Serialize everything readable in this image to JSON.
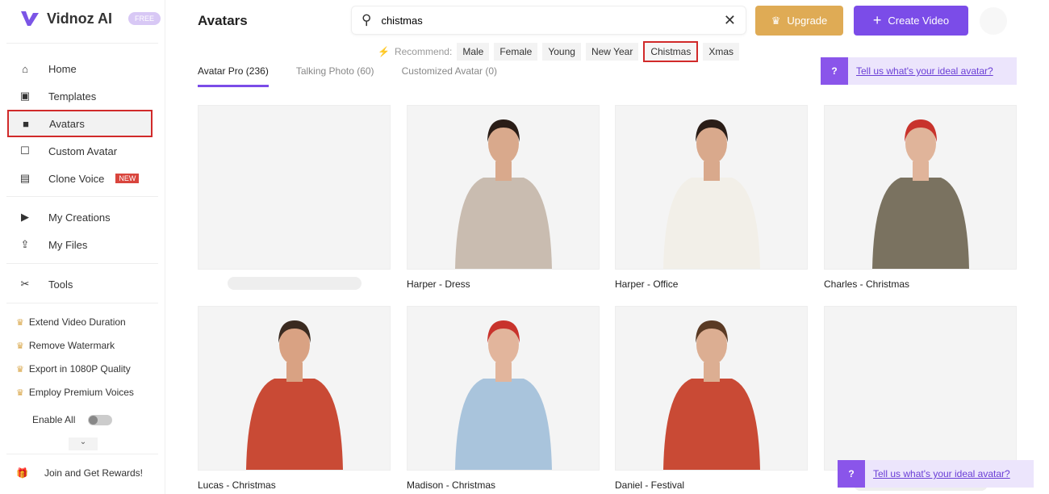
{
  "brand": {
    "name": "Vidnoz AI",
    "badge": "FREE",
    "accent": "#7b4ce8"
  },
  "sidebar": {
    "items": [
      {
        "label": "Home",
        "icon": "home-icon"
      },
      {
        "label": "Templates",
        "icon": "templates-icon"
      },
      {
        "label": "Avatars",
        "icon": "avatar-icon"
      },
      {
        "label": "Custom Avatar",
        "icon": "custom-avatar-icon"
      },
      {
        "label": "Clone Voice",
        "icon": "voice-icon",
        "badge": "NEW"
      },
      {
        "label": "My Creations",
        "icon": "play-icon"
      },
      {
        "label": "My Files",
        "icon": "upload-icon"
      },
      {
        "label": "Tools",
        "icon": "tools-icon"
      }
    ],
    "perks": [
      "Extend Video Duration",
      "Remove Watermark",
      "Export in 1080P Quality",
      "Employ Premium Voices"
    ],
    "enable_all": "Enable All",
    "rewards": "Join and Get Rewards!"
  },
  "header": {
    "title": "Avatars",
    "search_value": "chistmas",
    "upgrade": "Upgrade",
    "create": "Create Video"
  },
  "recommend": {
    "label": "Recommend:",
    "chips": [
      "Male",
      "Female",
      "Young",
      "New Year",
      "Chistmas",
      "Xmas"
    ],
    "selected": "Chistmas"
  },
  "tabs": [
    "Avatar Pro (236)",
    "Talking Photo (60)",
    "Customized Avatar (0)"
  ],
  "feedback": "Tell us what's your ideal avatar?",
  "avatars": [
    {
      "name": ""
    },
    {
      "name": "Harper - Dress",
      "top": "#c9bcb0",
      "skin": "#d9a98c",
      "hair": "#2a1d17"
    },
    {
      "name": "Harper - Office",
      "top": "#f2efe8",
      "skin": "#d9a98c",
      "hair": "#2a1d17"
    },
    {
      "name": "Charles - Christmas",
      "top": "#7a7260",
      "skin": "#e0b49a",
      "hair": "#c8332c"
    },
    {
      "name": "Lucas - Christmas",
      "top": "#c94a35",
      "skin": "#d9a283",
      "hair": "#3a2a20"
    },
    {
      "name": "Madison - Christmas",
      "top": "#a9c4dc",
      "skin": "#e2b59c",
      "hair": "#c8332c"
    },
    {
      "name": "Daniel - Festival",
      "top": "#c94a35",
      "skin": "#dcae92",
      "hair": "#5a3a24"
    },
    {
      "name": ""
    }
  ]
}
